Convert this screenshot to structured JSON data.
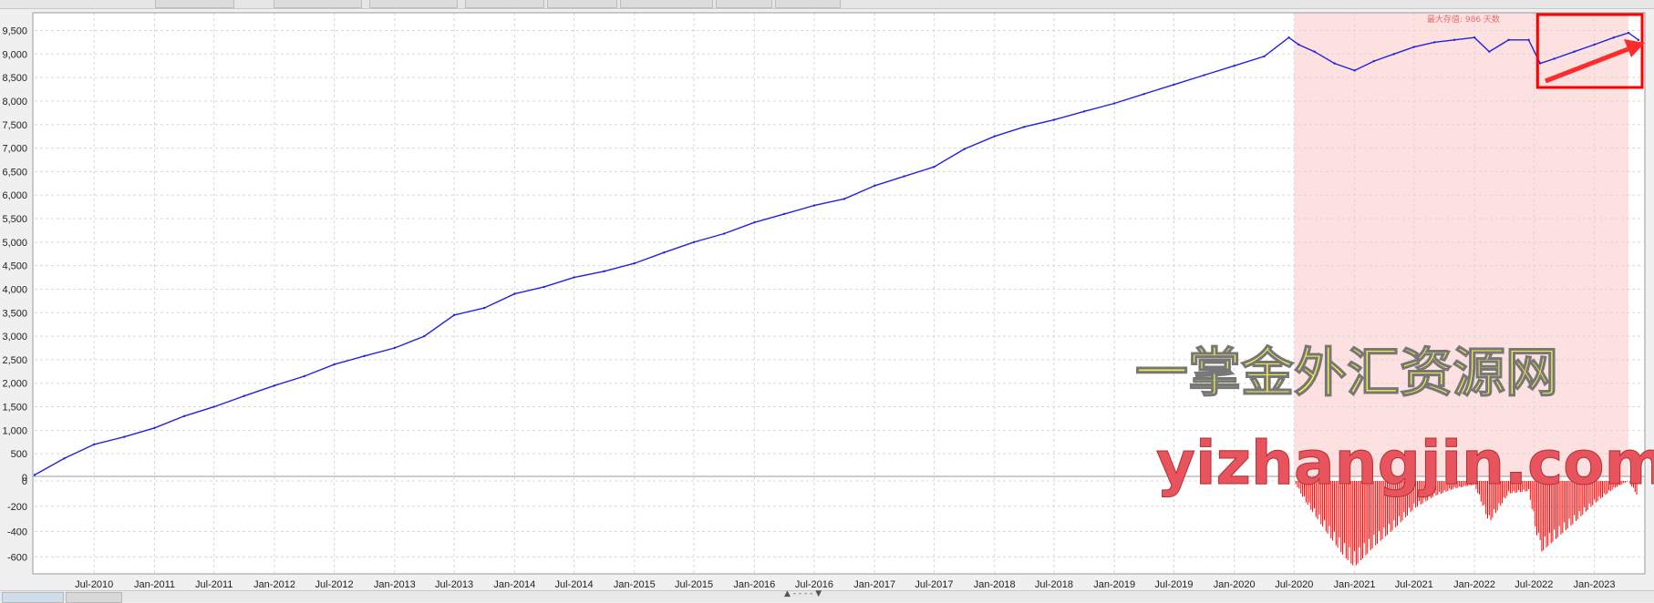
{
  "chart_data": {
    "type": "line",
    "panels": [
      {
        "name": "equity",
        "y_ticks": [
          0,
          500,
          1000,
          1500,
          2000,
          2500,
          3000,
          3500,
          4000,
          4500,
          5000,
          5500,
          6000,
          6500,
          7000,
          7500,
          8000,
          8500,
          9000,
          9500
        ],
        "y_tick_labels": [
          "0",
          "500",
          "1,000",
          "1,500",
          "2,000",
          "2,500",
          "3,000",
          "3,500",
          "4,000",
          "4,500",
          "5,000",
          "5,500",
          "6,000",
          "6,500",
          "7,000",
          "7,500",
          "8,000",
          "8,500",
          "9,000",
          "9,500"
        ],
        "ylim": [
          0,
          9800
        ],
        "series_color": "#2222dd",
        "points": [
          [
            "2010-01-01",
            50
          ],
          [
            "2010-04-01",
            400
          ],
          [
            "2010-07-01",
            700
          ],
          [
            "2010-10-01",
            860
          ],
          [
            "2011-01-01",
            1050
          ],
          [
            "2011-04-01",
            1300
          ],
          [
            "2011-07-01",
            1500
          ],
          [
            "2011-10-01",
            1730
          ],
          [
            "2012-01-01",
            1950
          ],
          [
            "2012-04-01",
            2150
          ],
          [
            "2012-07-01",
            2400
          ],
          [
            "2012-10-01",
            2580
          ],
          [
            "2013-01-01",
            2750
          ],
          [
            "2013-04-01",
            3000
          ],
          [
            "2013-07-01",
            3450
          ],
          [
            "2013-10-01",
            3600
          ],
          [
            "2014-01-01",
            3900
          ],
          [
            "2014-04-01",
            4050
          ],
          [
            "2014-07-01",
            4250
          ],
          [
            "2014-10-01",
            4380
          ],
          [
            "2015-01-01",
            4550
          ],
          [
            "2015-04-01",
            4780
          ],
          [
            "2015-07-01",
            5000
          ],
          [
            "2015-10-01",
            5180
          ],
          [
            "2016-01-01",
            5420
          ],
          [
            "2016-04-01",
            5600
          ],
          [
            "2016-07-01",
            5780
          ],
          [
            "2016-10-01",
            5920
          ],
          [
            "2017-01-01",
            6200
          ],
          [
            "2017-04-01",
            6400
          ],
          [
            "2017-07-01",
            6600
          ],
          [
            "2017-10-01",
            6980
          ],
          [
            "2018-01-01",
            7250
          ],
          [
            "2018-04-01",
            7450
          ],
          [
            "2018-07-01",
            7600
          ],
          [
            "2018-10-01",
            7780
          ],
          [
            "2019-01-01",
            7950
          ],
          [
            "2019-04-01",
            8150
          ],
          [
            "2019-07-01",
            8350
          ],
          [
            "2019-10-01",
            8550
          ],
          [
            "2020-01-01",
            8750
          ],
          [
            "2020-04-01",
            8950
          ],
          [
            "2020-06-15",
            9350
          ],
          [
            "2020-07-15",
            9200
          ],
          [
            "2020-09-01",
            9050
          ],
          [
            "2020-11-01",
            8800
          ],
          [
            "2021-01-01",
            8650
          ],
          [
            "2021-03-01",
            8850
          ],
          [
            "2021-05-01",
            9000
          ],
          [
            "2021-07-01",
            9150
          ],
          [
            "2021-09-01",
            9250
          ],
          [
            "2021-11-01",
            9300
          ],
          [
            "2022-01-01",
            9350
          ],
          [
            "2022-02-15",
            9050
          ],
          [
            "2022-04-15",
            9300
          ],
          [
            "2022-06-15",
            9300
          ],
          [
            "2022-07-20",
            8800
          ],
          [
            "2022-09-01",
            8900
          ],
          [
            "2022-11-01",
            9050
          ],
          [
            "2023-01-01",
            9200
          ],
          [
            "2023-03-01",
            9350
          ],
          [
            "2023-04-15",
            9450
          ],
          [
            "2023-05-15",
            9300
          ]
        ]
      },
      {
        "name": "drawdown",
        "y_ticks": [
          0,
          -200,
          -400,
          -600
        ],
        "y_tick_labels": [
          "0",
          "-200",
          "-400",
          "-600"
        ],
        "ylim": [
          -720,
          0
        ],
        "series_color": "#ff0000",
        "points": [
          [
            "2020-07-01",
            0
          ],
          [
            "2020-08-01",
            -150
          ],
          [
            "2020-10-01",
            -380
          ],
          [
            "2020-12-01",
            -600
          ],
          [
            "2021-01-01",
            -680
          ],
          [
            "2021-03-01",
            -520
          ],
          [
            "2021-05-01",
            -380
          ],
          [
            "2021-07-01",
            -220
          ],
          [
            "2021-09-01",
            -120
          ],
          [
            "2021-11-01",
            -60
          ],
          [
            "2022-01-01",
            -30
          ],
          [
            "2022-02-15",
            -330
          ],
          [
            "2022-04-15",
            -100
          ],
          [
            "2022-06-15",
            -80
          ],
          [
            "2022-07-20",
            -570
          ],
          [
            "2022-09-01",
            -470
          ],
          [
            "2022-11-01",
            -330
          ],
          [
            "2023-01-01",
            -180
          ],
          [
            "2023-03-01",
            -60
          ],
          [
            "2023-04-15",
            0
          ],
          [
            "2023-05-15",
            -130
          ]
        ]
      }
    ],
    "x_tick_labels": [
      "Jul-2010",
      "Jan-2011",
      "Jul-2011",
      "Jan-2012",
      "Jul-2012",
      "Jan-2013",
      "Jul-2013",
      "Jan-2014",
      "Jul-2014",
      "Jan-2015",
      "Jul-2015",
      "Jan-2016",
      "Jul-2016",
      "Jan-2017",
      "Jul-2017",
      "Jan-2018",
      "Jul-2018",
      "Jan-2019",
      "Jul-2019",
      "Jan-2020",
      "Jul-2020",
      "Jan-2021",
      "Jul-2021",
      "Jan-2022",
      "Jul-2022",
      "Jan-2023"
    ],
    "x_ticks": [
      "2010-07-01",
      "2011-01-01",
      "2011-07-01",
      "2012-01-01",
      "2012-07-01",
      "2013-01-01",
      "2013-07-01",
      "2014-01-01",
      "2014-07-01",
      "2015-01-01",
      "2015-07-01",
      "2016-01-01",
      "2016-07-01",
      "2017-01-01",
      "2017-07-01",
      "2018-01-01",
      "2018-07-01",
      "2019-01-01",
      "2019-07-01",
      "2020-01-01",
      "2020-07-01",
      "2021-01-01",
      "2021-07-01",
      "2022-01-01",
      "2022-07-01",
      "2023-01-01"
    ],
    "xlim": [
      "2010-01-01",
      "2023-06-01"
    ],
    "max_drawdown_period": {
      "start": "2020-07-01",
      "end": "2023-04-15",
      "label": "最大存值: 986 天数",
      "shade_color": "#fde0e0"
    },
    "highlight_box": {
      "start": "2022-07-01",
      "end": "2023-06-01",
      "color": "#ff0000"
    },
    "grid": true
  },
  "watermark": {
    "line1": "一掌金外汇资源网",
    "line2": "yizhangjin.com"
  },
  "colors": {
    "equity_line": "#2222dd",
    "drawdown_bars": "#ff0000",
    "shade": "#fde0e0",
    "grid": "#d8d8d8"
  }
}
